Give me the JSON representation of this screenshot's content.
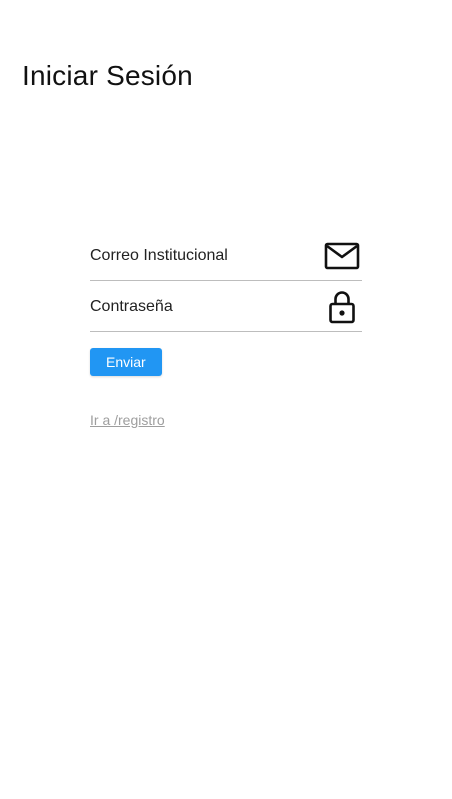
{
  "page": {
    "title": "Iniciar Sesión"
  },
  "form": {
    "email": {
      "placeholder": "Correo Institucional",
      "value": "",
      "icon": "mail-icon"
    },
    "password": {
      "placeholder": "Contraseña",
      "value": "",
      "icon": "lock-icon"
    },
    "submit_label": "Enviar",
    "register_link": "Ir a /registro"
  },
  "colors": {
    "accent": "#2196f3",
    "link": "#9e9e9e",
    "divider": "#bdbdbd"
  }
}
